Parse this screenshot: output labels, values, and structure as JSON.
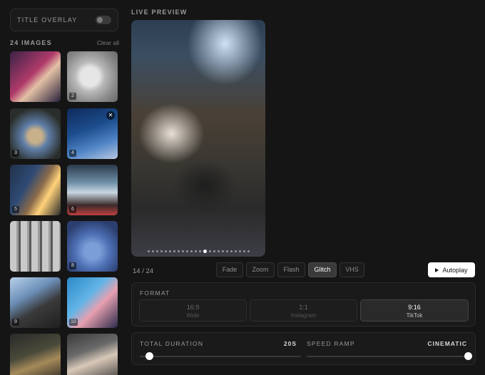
{
  "title_overlay": {
    "label": "TITLE OVERLAY",
    "enabled": false
  },
  "images": {
    "count_label": "24 IMAGES",
    "clear_label": "Clear all",
    "thumbnails": [
      {
        "num": ""
      },
      {
        "num": "2"
      },
      {
        "num": "3"
      },
      {
        "num": "4"
      },
      {
        "num": "5"
      },
      {
        "num": "6"
      },
      {
        "num": ""
      },
      {
        "num": "8"
      },
      {
        "num": "9"
      },
      {
        "num": "10"
      },
      {
        "num": ""
      },
      {
        "num": ""
      }
    ]
  },
  "preview": {
    "label": "LIVE PREVIEW",
    "counter": "14 / 24",
    "dots_total": 24,
    "active_dot": 13
  },
  "transitions": {
    "items": [
      "Fade",
      "Zoom",
      "Flash",
      "Glitch",
      "VHS"
    ],
    "selected": "Glitch"
  },
  "autoplay_label": "Autoplay",
  "format": {
    "label": "FORMAT",
    "options": [
      {
        "ratio": "16:9",
        "name": "Wide"
      },
      {
        "ratio": "1:1",
        "name": "Instagram"
      },
      {
        "ratio": "9:16",
        "name": "TikTok"
      }
    ],
    "selected": "9:16"
  },
  "total_duration": {
    "label": "TOTAL DURATION",
    "value": "20S",
    "fraction": 0.06
  },
  "speed_ramp": {
    "label": "SPEED RAMP",
    "value": "CINEMATIC",
    "fraction": 1.0
  },
  "colors": {
    "accent": "#ffffff",
    "background": "#151515",
    "panel": "#1a1a1a"
  },
  "icons": {
    "remove": "close-icon",
    "play": "play-icon"
  }
}
